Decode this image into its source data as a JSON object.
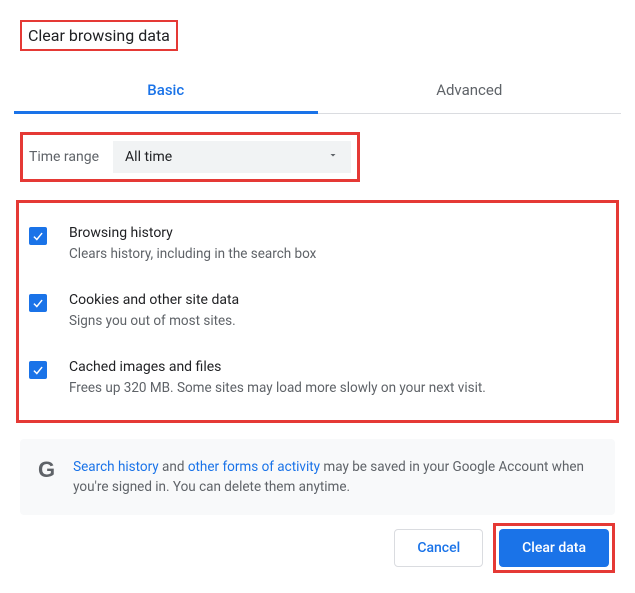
{
  "title": "Clear browsing data",
  "tabs": {
    "basic": "Basic",
    "advanced": "Advanced"
  },
  "timeRange": {
    "label": "Time range",
    "value": "All time"
  },
  "options": [
    {
      "title": "Browsing history",
      "desc": "Clears history, including in the search box"
    },
    {
      "title": "Cookies and other site data",
      "desc": "Signs you out of most sites."
    },
    {
      "title": "Cached images and files",
      "desc": "Frees up 320 MB. Some sites may load more slowly on your next visit."
    }
  ],
  "info": {
    "link1": "Search history",
    "mid1": " and ",
    "link2": "other forms of activity",
    "rest": " may be saved in your Google Account when you're signed in. You can delete them anytime."
  },
  "buttons": {
    "cancel": "Cancel",
    "clear": "Clear data"
  }
}
